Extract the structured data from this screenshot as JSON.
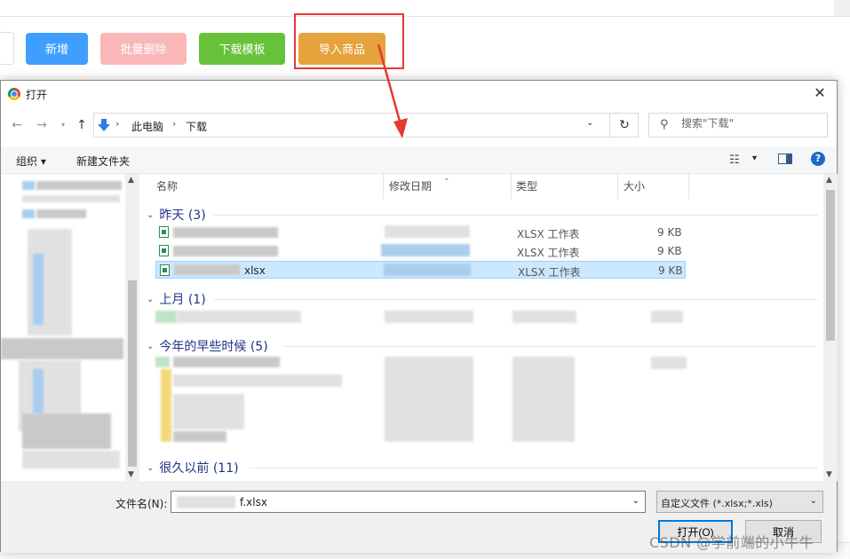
{
  "page": {
    "buttons": [
      {
        "label": "新增",
        "color": "#409eff"
      },
      {
        "label": "批量删除",
        "color": "#f9b7b8"
      },
      {
        "label": "下载模板",
        "color": "#67c23a"
      },
      {
        "label": "导入商品",
        "color": "#e6a23c"
      }
    ],
    "highlight_color": "#e53935"
  },
  "dialog": {
    "title": "打开",
    "address": {
      "crumbs": [
        "此电脑",
        "下载"
      ]
    },
    "search": {
      "placeholder": "搜索\"下载\""
    },
    "toolbar": {
      "organize": "组织",
      "new_folder": "新建文件夹"
    },
    "columns": {
      "name": "名称",
      "date": "修改日期",
      "type": "类型",
      "size": "大小"
    },
    "groups": [
      {
        "label": "昨天 (3)"
      },
      {
        "label": "上月 (1)"
      },
      {
        "label": "今年的早些时候 (5)"
      },
      {
        "label": "很久以前 (11)"
      }
    ],
    "files": [
      {
        "name": "",
        "type": "XLSX 工作表",
        "size": "9 KB"
      },
      {
        "name": "",
        "type": "XLSX 工作表",
        "size": "9 KB"
      },
      {
        "name": "xlsx",
        "type": "XLSX 工作表",
        "size": "9 KB"
      }
    ],
    "filename": {
      "label": "文件名(N):",
      "value": "f.xlsx"
    },
    "filetype": {
      "value": "自定义文件 (*.xlsx;*.xls)"
    },
    "open_label": "打开(O)",
    "cancel_label": "取消",
    "selection_color": "#cce8ff",
    "group_color": "#1e3287"
  },
  "watermark": "CSDN @学前端的小牛牛"
}
